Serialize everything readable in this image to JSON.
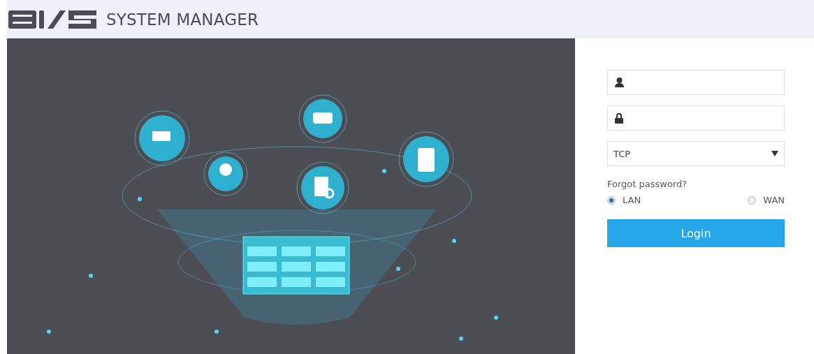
{
  "header": {
    "title": "SYSTEM MANAGER"
  },
  "login": {
    "fields": [
      {
        "kind": "user"
      },
      {
        "kind": "password"
      }
    ],
    "protocol": {
      "value": "TCP"
    },
    "forgot_link": "Forgot password?",
    "network": [
      {
        "label": "LAN",
        "selected": true
      },
      {
        "label": "WAN",
        "selected": false
      }
    ],
    "submit": "Login"
  }
}
